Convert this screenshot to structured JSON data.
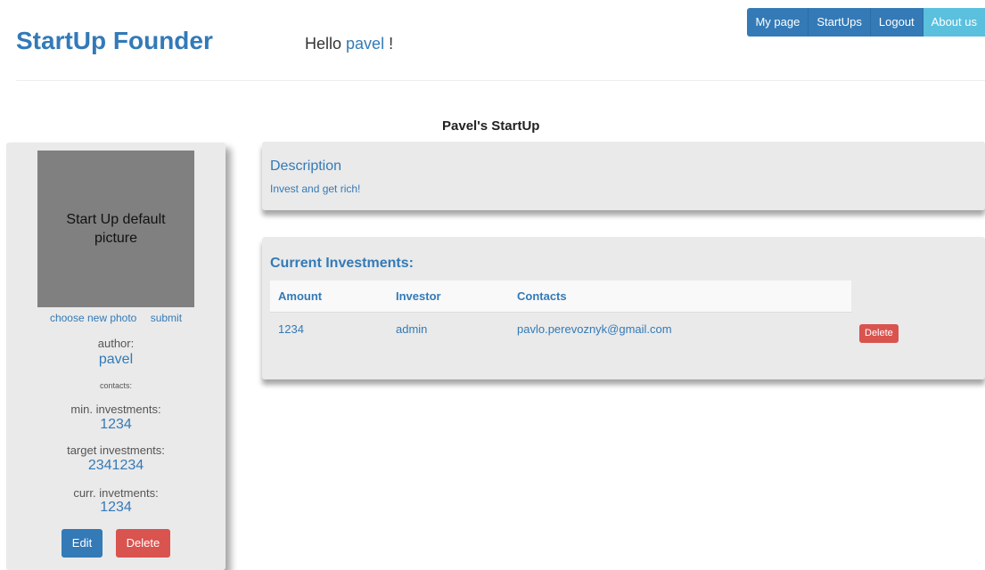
{
  "header": {
    "brand": "StartUp Founder",
    "greeting_prefix": "Hello ",
    "username": "pavel",
    "greeting_suffix": " !",
    "nav": {
      "my_page": "My page",
      "startups": "StartUps",
      "logout": "Logout",
      "about": "About us"
    }
  },
  "startup": {
    "title": "Pavel's StartUp"
  },
  "sidebar": {
    "photo_text": "Start Up default picture",
    "choose_photo": "choose new photo",
    "submit": "submit",
    "author_label": "author:",
    "author": "pavel",
    "contacts_label": "contacts:",
    "min_label": "min. investments:",
    "min_value": "1234",
    "target_label": "target investments:",
    "target_value": "2341234",
    "curr_label": "curr. invetments:",
    "curr_value": "1234",
    "edit_label": "Edit",
    "delete_label": "Delete"
  },
  "description": {
    "title": "Description",
    "text": "Invest and get rich!"
  },
  "investments": {
    "title": "Current Investments:",
    "columns": [
      "Amount",
      "Investor",
      "Contacts"
    ],
    "rows": [
      {
        "amount": "1234",
        "investor": "admin",
        "contacts": "pavlo.perevoznyk@gmail.com",
        "delete_label": "Delete"
      }
    ]
  },
  "colors": {
    "primary": "#337ab7",
    "info": "#5bc0de",
    "danger": "#d9534f",
    "panel": "#eaeaea",
    "photo": "#808080"
  }
}
